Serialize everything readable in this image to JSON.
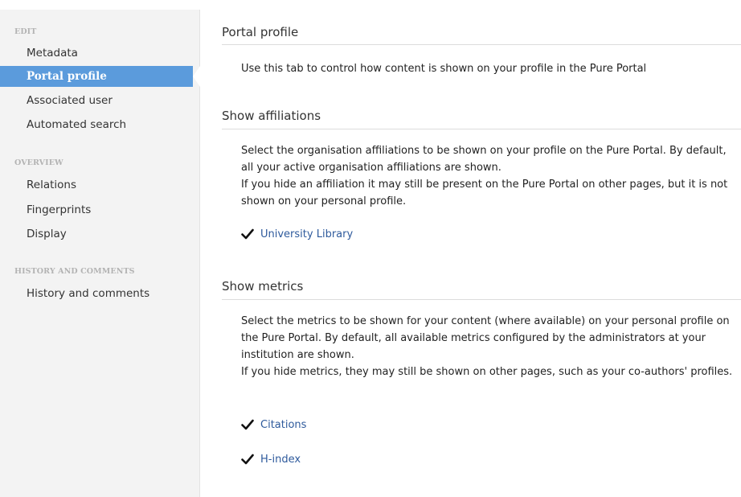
{
  "sidebar": {
    "sections": [
      {
        "heading": "EDIT",
        "items": [
          "Metadata",
          "Portal profile",
          "Associated user",
          "Automated search"
        ]
      },
      {
        "heading": "OVERVIEW",
        "items": [
          "Relations",
          "Fingerprints",
          "Display"
        ]
      },
      {
        "heading": "HISTORY AND COMMENTS",
        "items": [
          "History and comments"
        ]
      }
    ],
    "active_item": "Portal profile",
    "active_color": "#5b9bdc"
  },
  "main": {
    "portal_profile": {
      "title": "Portal profile",
      "description": "Use this tab to control how content is shown on your profile in the Pure Portal"
    },
    "affiliations": {
      "title": "Show affiliations",
      "para1": "Select the organisation affiliations to be shown on your profile on the Pure Portal. By default, all your active organisation affiliations are shown.",
      "para2": "If you hide an affiliation it may still be present on the Pure Portal on other pages, but it is not shown on your personal profile.",
      "options": [
        {
          "label": "University Library",
          "checked": true
        }
      ]
    },
    "metrics": {
      "title": "Show metrics",
      "para1": "Select the metrics to be shown for your content (where available) on your personal profile on the Pure Portal. By default, all available metrics configured by the administrators at your institution are shown.",
      "para2": "If you hide metrics, they may still be shown on other pages, such as your co-authors' profiles.",
      "options": [
        {
          "label": "Citations",
          "checked": true
        },
        {
          "label": "H-index",
          "checked": true
        }
      ]
    }
  }
}
